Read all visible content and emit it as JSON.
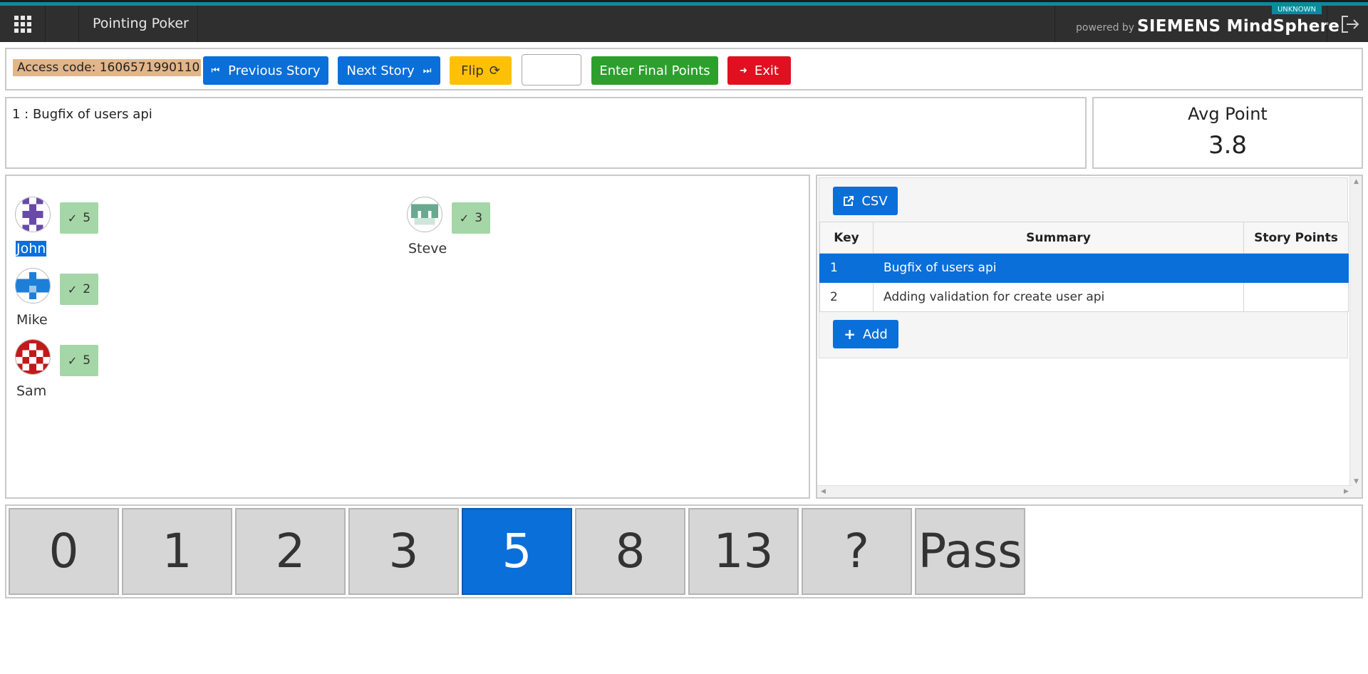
{
  "header": {
    "app_title": "Pointing Poker",
    "powered_by": "powered by",
    "brand": "SIEMENS MindSphere",
    "badge": "UNKNOWN"
  },
  "toolbar": {
    "access_code": "Access code: 1606571990110",
    "previous_story": "Previous Story",
    "next_story": "Next Story",
    "flip": "Flip",
    "final_points_value": "",
    "enter_final_points": "Enter Final Points",
    "exit": "Exit"
  },
  "story": {
    "current": "1 : Bugfix of users api"
  },
  "average": {
    "label": "Avg Point",
    "value": "3.8"
  },
  "players": [
    {
      "name": "John",
      "vote": "5",
      "avatar_color": "#6a4aa8",
      "selected": true
    },
    {
      "name": "Steve",
      "vote": "3",
      "avatar_color": "#6aa892",
      "selected": false
    },
    {
      "name": "Mike",
      "vote": "2",
      "avatar_color": "#1e7fd6",
      "selected": false
    },
    {
      "name": "Sam",
      "vote": "5",
      "avatar_color": "#c01a1a",
      "selected": false
    }
  ],
  "stories_table": {
    "csv_label": "CSV",
    "add_label": "Add",
    "columns": [
      "Key",
      "Summary",
      "Story Points"
    ],
    "rows": [
      {
        "key": "1",
        "summary": "Bugfix of users api",
        "points": "",
        "active": true
      },
      {
        "key": "2",
        "summary": "Adding validation for create user api",
        "points": "",
        "active": false
      }
    ]
  },
  "cards": {
    "values": [
      "0",
      "1",
      "2",
      "3",
      "5",
      "8",
      "13",
      "?",
      "Pass"
    ],
    "selected": "5"
  },
  "colors": {
    "primary": "#0a6fd8",
    "warning": "#ffc107",
    "success": "#2d9f2d",
    "danger": "#e01020",
    "vote_chip": "#a5d6a7",
    "access_code_bg": "#e2b68a"
  },
  "icons": {
    "apps": "grid-icon",
    "logout": "logout-icon",
    "previous": "step-backward-icon",
    "next": "step-forward-icon",
    "flip": "refresh-icon",
    "exit": "sign-out-icon",
    "csv": "external-link-icon",
    "add": "plus-icon",
    "vote": "check-icon"
  }
}
